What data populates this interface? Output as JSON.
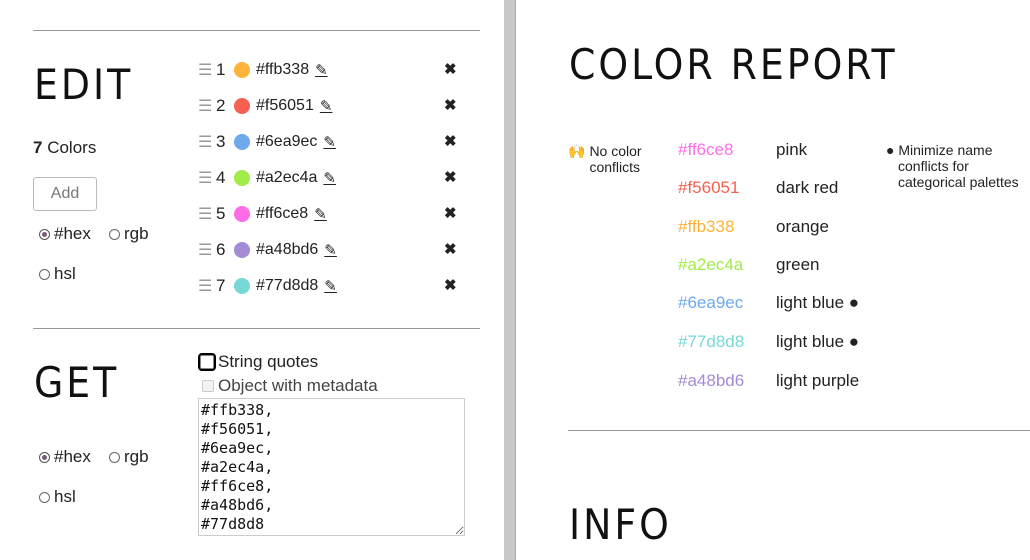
{
  "edit": {
    "title": "EDIT",
    "count_number": "7",
    "count_label": "Colors",
    "add_label": "Add",
    "formats": [
      {
        "label": "#hex",
        "selected": true
      },
      {
        "label": "rgb",
        "selected": false
      },
      {
        "label": "hsl",
        "selected": false
      }
    ],
    "colors": [
      {
        "index": "1",
        "hex": "#ffb338",
        "color": "#ffb338",
        "handle": "☰",
        "edit": "✎",
        "remove": "✖"
      },
      {
        "index": "2",
        "hex": "#f56051",
        "color": "#f56051",
        "handle": "☰",
        "edit": "✎",
        "remove": "✖"
      },
      {
        "index": "3",
        "hex": "#6ea9ec",
        "color": "#6ea9ec",
        "handle": "☰",
        "edit": "✎",
        "remove": "✖"
      },
      {
        "index": "4",
        "hex": "#a2ec4a",
        "color": "#a2ec4a",
        "handle": "☰",
        "edit": "✎",
        "remove": "✖"
      },
      {
        "index": "5",
        "hex": "#ff6ce8",
        "color": "#ff6ce8",
        "handle": "☰",
        "edit": "✎",
        "remove": "✖"
      },
      {
        "index": "6",
        "hex": "#a48bd6",
        "color": "#a48bd6",
        "handle": "☰",
        "edit": "✎",
        "remove": "✖"
      },
      {
        "index": "7",
        "hex": "#77d8d8",
        "color": "#77d8d8",
        "handle": "☰",
        "edit": "✎",
        "remove": "✖"
      }
    ]
  },
  "get": {
    "title": "GET",
    "string_quotes_label": "String quotes",
    "metadata_label": "Object with metadata",
    "output": "#ffb338,\n#f56051,\n#6ea9ec,\n#a2ec4a,\n#ff6ce8,\n#a48bd6,\n#77d8d8",
    "formats": [
      {
        "label": "#hex",
        "selected": true
      },
      {
        "label": "rgb",
        "selected": false
      },
      {
        "label": "hsl",
        "selected": false
      }
    ]
  },
  "report": {
    "title": "COLOR REPORT",
    "conflict_icon": "🙌",
    "conflict_text_1": "No color",
    "conflict_text_2": "conflicts",
    "rows": [
      {
        "hex": "#ff6ce8",
        "color": "#ff6ce8",
        "name": "pink"
      },
      {
        "hex": "#f56051",
        "color": "#f56051",
        "name": "dark red"
      },
      {
        "hex": "#ffb338",
        "color": "#ffb338",
        "name": "orange"
      },
      {
        "hex": "#a2ec4a",
        "color": "#a2ec4a",
        "name": "green"
      },
      {
        "hex": "#6ea9ec",
        "color": "#6ea9ec",
        "name": "light blue ●"
      },
      {
        "hex": "#77d8d8",
        "color": "#77d8d8",
        "name": "light blue ●"
      },
      {
        "hex": "#a48bd6",
        "color": "#a48bd6",
        "name": "light purple"
      }
    ],
    "tip_line_1": "● Minimize name",
    "tip_line_2": "conflicts for",
    "tip_line_3": "categorical palettes"
  },
  "info": {
    "title": "INFO"
  }
}
